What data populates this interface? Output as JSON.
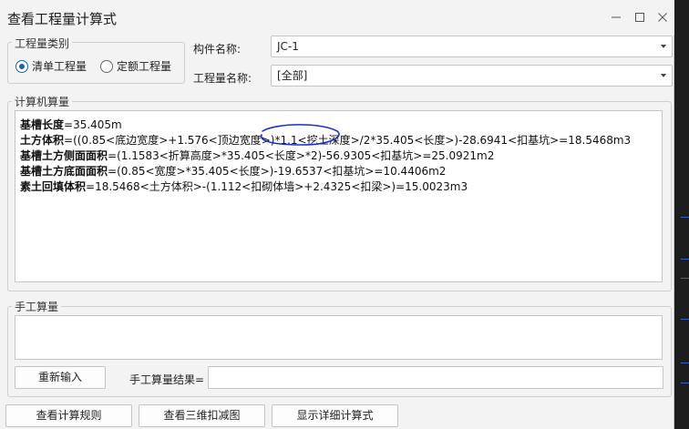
{
  "window": {
    "title": "查看工程量计算式",
    "minimize_glyph": "–",
    "close_glyph": "✕"
  },
  "quantity_type": {
    "legend": "工程量类别",
    "options": [
      {
        "label": "清单工程量",
        "checked": true
      },
      {
        "label": "定额工程量",
        "checked": false
      }
    ]
  },
  "component": {
    "label": "构件名称:",
    "value": "JC-1"
  },
  "quantity_name": {
    "label": "工程量名称:",
    "value": "[全部]"
  },
  "computed": {
    "legend": "计算机算量",
    "lines": [
      {
        "name": "基槽长度",
        "expr": "=35.405m"
      },
      {
        "name": "土方体积",
        "expr": "=((0.85<底边宽度>+1.576<顶边宽度>)*1.1<挖土深度>/2*35.405<长度>)-28.6941<扣基坑>=18.5468m3"
      },
      {
        "name": "基槽土方侧面面积",
        "expr": "=(1.1583<折算高度>*35.405<长度>*2)-56.9305<扣基坑>=25.0921m2"
      },
      {
        "name": "基槽土方底面面积",
        "expr": "=(0.85<宽度>*35.405<长度>)-19.6537<扣基坑>=10.4406m2"
      },
      {
        "name": "素土回填体积",
        "expr": "=18.5468<土方体积>-(1.112<扣砌体墙>+2.4325<扣梁>)=15.0023m3"
      }
    ]
  },
  "manual": {
    "legend": "手工算量",
    "reenter_label": "重新输入",
    "result_label": "手工算量结果=",
    "result_value": ""
  },
  "footer": {
    "rules_label": "查看计算规则",
    "view3d_label": "查看三维扣减图",
    "detail_label": "显示详细计算式"
  },
  "colors": {
    "annotation_ellipse": "#1a2fd0",
    "radio_accent": "#1a5fb4"
  }
}
